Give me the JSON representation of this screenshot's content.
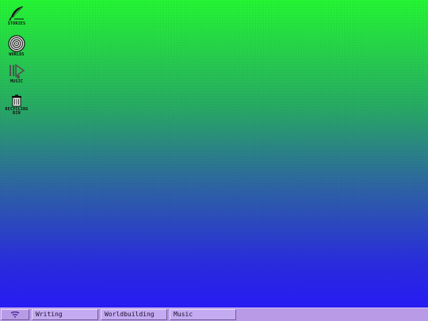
{
  "desktop": {
    "icons": [
      {
        "label": "STORIES",
        "icon": "quill-icon"
      },
      {
        "label": "WORLDS",
        "icon": "spiral-icon"
      },
      {
        "label": "MUSIC",
        "icon": "music-play-icon"
      },
      {
        "label": "RECYCLING BIN",
        "icon": "recycling-bin-icon"
      }
    ]
  },
  "taskbar": {
    "start_icon": "start-menu-icon",
    "tasks": [
      {
        "label": "Writing"
      },
      {
        "label": "Worldbuilding"
      },
      {
        "label": "Music"
      }
    ],
    "colors": {
      "bar": "#b89ae6",
      "button": "#c4aaf0"
    }
  },
  "colors": {
    "gradient_top": "#26ff36",
    "gradient_bottom": "#2a1cff"
  }
}
